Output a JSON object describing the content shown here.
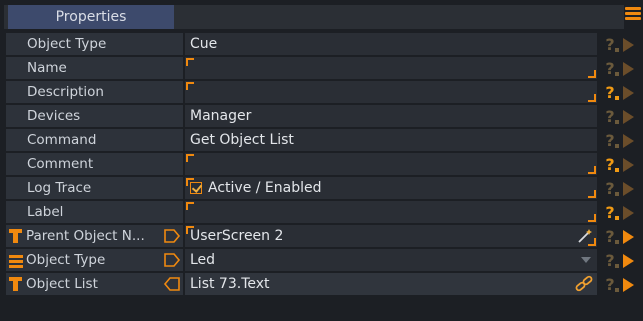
{
  "panel": {
    "tab_label": "Properties",
    "accent_color": "#f0890f"
  },
  "rows": [
    {
      "label": "Object Type",
      "value": "Cue",
      "help_active": false,
      "play_active": false
    },
    {
      "label": "Name",
      "value": "",
      "help_active": false,
      "play_active": false
    },
    {
      "label": "Description",
      "value": "",
      "help_active": true,
      "play_active": false
    },
    {
      "label": "Devices",
      "value": "Manager",
      "help_active": false,
      "play_active": false
    },
    {
      "label": "Command",
      "value": "Get Object List",
      "help_active": false,
      "play_active": false
    },
    {
      "label": "Comment",
      "value": "",
      "help_active": true,
      "play_active": false
    },
    {
      "label": "Log Trace",
      "value": "Active / Enabled",
      "checked": true,
      "help_active": false,
      "play_active": false
    },
    {
      "label": "Label",
      "value": "",
      "help_active": true,
      "play_active": false
    },
    {
      "label": "Parent Object N...",
      "value": "UserScreen  2",
      "type_icon": "text-type-icon",
      "help_active": false,
      "play_active": true
    },
    {
      "label": "Object Type",
      "value": "Led",
      "type_icon": "list-type-icon",
      "help_active": false,
      "play_active": true
    },
    {
      "label": "Object List",
      "value": "List  73.Text",
      "type_icon": "text-type-icon",
      "help_active": false,
      "play_active": true
    }
  ]
}
